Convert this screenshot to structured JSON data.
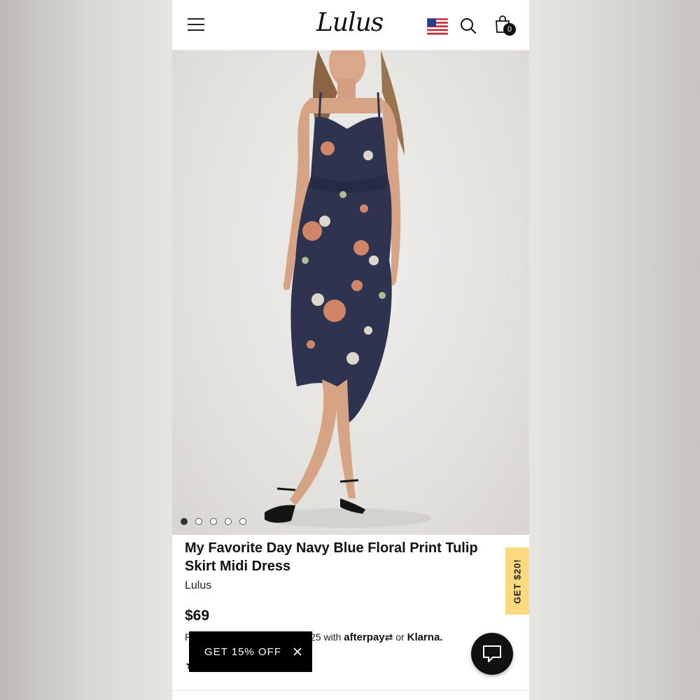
{
  "header": {
    "logo_text": "Lulus",
    "cart_count": "0",
    "icons": [
      "menu-icon",
      "us-flag-icon",
      "search-icon",
      "shopping-bag-icon"
    ]
  },
  "gallery": {
    "image_count": 5,
    "active_index": 0
  },
  "product": {
    "title": "My Favorite Day Navy Blue Floral Print Tulip Skirt Midi Dress",
    "brand": "Lulus",
    "price": "$69",
    "installments_prefix": "P",
    "installments_amount": "7.25 with",
    "afterpay_label": "afterpay",
    "or_text": "or",
    "klarna_label": "Klarna.",
    "stars": "★"
  },
  "side_tab": {
    "label": "GET $20!"
  },
  "promo_bar": {
    "label": "GET 15% OFF"
  },
  "colors": {
    "side_tab_bg": "#fbd97e",
    "dress_navy": "#2e3350",
    "flower_rust": "#d98a68"
  }
}
